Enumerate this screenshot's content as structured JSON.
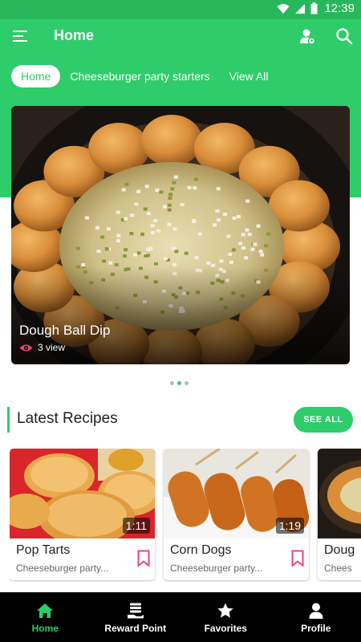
{
  "status_bar": {
    "time": "12:39"
  },
  "app_bar": {
    "title": "Home"
  },
  "tabs": [
    {
      "label": "Home",
      "active": true
    },
    {
      "label": "Cheeseburger party starters",
      "active": false
    },
    {
      "label": "View All",
      "active": false
    }
  ],
  "featured": {
    "title": "Dough Ball Dip",
    "views": "3 view"
  },
  "carousel": {
    "page_count": 3,
    "active_index": 1
  },
  "latest": {
    "title": "Latest Recipes",
    "see_all_label": "SEE ALL",
    "recipes": [
      {
        "title": "Pop Tarts",
        "category": "Cheeseburger party...",
        "duration": "1:11"
      },
      {
        "title": "Corn Dogs",
        "category": "Cheeseburger party...",
        "duration": "1:19"
      },
      {
        "title": "Doug",
        "category": "Chees",
        "duration": ""
      }
    ]
  },
  "bottom_nav": [
    {
      "label": "Home",
      "icon": "home-icon",
      "active": true
    },
    {
      "label": "Reward Point",
      "icon": "reward-icon",
      "active": false
    },
    {
      "label": "Favorites",
      "icon": "star-icon",
      "active": false
    },
    {
      "label": "Profile",
      "icon": "person-icon",
      "active": false
    }
  ],
  "colors": {
    "primary": "#2ecc6a",
    "accent_pink": "#e8477a",
    "nav_background": "#000000"
  }
}
